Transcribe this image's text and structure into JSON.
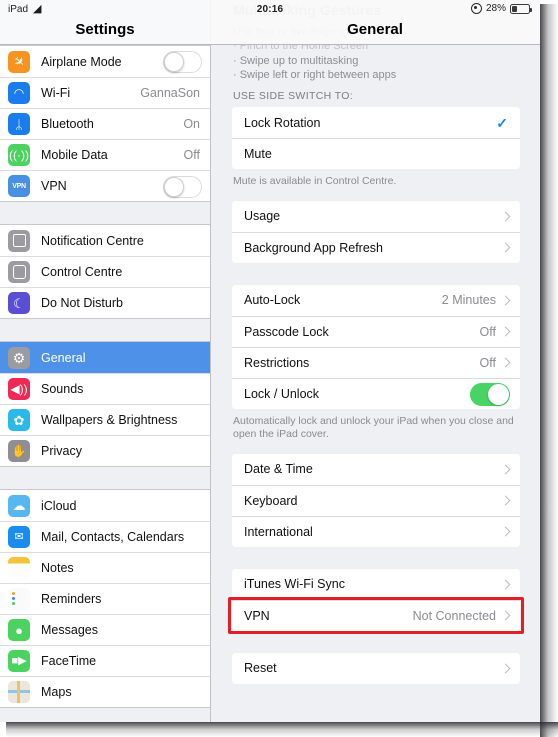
{
  "status_bar": {
    "device_label": "iPad",
    "wifi_icon": "wifi-icon",
    "time": "20:16",
    "rotation_lock_icon": "rotation-lock-icon",
    "battery_percent": "28%",
    "battery_level": 28
  },
  "sidebar": {
    "title": "Settings",
    "groups": [
      {
        "items": [
          {
            "label": "Airplane Mode",
            "icon": "airplane-icon",
            "icon_color": "#f79421",
            "accessory": "toggle",
            "toggle_on": false
          },
          {
            "label": "Wi-Fi",
            "icon": "wifi-icon",
            "icon_color": "#1a7ced",
            "value": "GannaSon",
            "accessory": "value"
          },
          {
            "label": "Bluetooth",
            "icon": "bluetooth-icon",
            "icon_color": "#1a7ced",
            "value": "On",
            "accessory": "value"
          },
          {
            "label": "Mobile Data",
            "icon": "cellular-icon",
            "icon_color": "#4cd35f",
            "value": "Off",
            "accessory": "value"
          },
          {
            "label": "VPN",
            "icon": "vpn-icon",
            "icon_color": "#4a90e2",
            "accessory": "toggle",
            "toggle_on": false
          }
        ]
      },
      {
        "items": [
          {
            "label": "Notification Centre",
            "icon": "notification-centre-icon",
            "icon_color": "#9b9ba0",
            "accessory": "none"
          },
          {
            "label": "Control Centre",
            "icon": "control-centre-icon",
            "icon_color": "#9b9ba0",
            "accessory": "none"
          },
          {
            "label": "Do Not Disturb",
            "icon": "moon-icon",
            "icon_color": "#5a4fd4",
            "accessory": "none"
          }
        ]
      },
      {
        "items": [
          {
            "label": "General",
            "icon": "gear-icon",
            "icon_color": "#9b9ba0",
            "accessory": "none",
            "selected": true
          },
          {
            "label": "Sounds",
            "icon": "speaker-icon",
            "icon_color": "#ee2a54",
            "accessory": "none"
          },
          {
            "label": "Wallpapers & Brightness",
            "icon": "wallpaper-icon",
            "icon_color": "#2ab9e8",
            "accessory": "none"
          },
          {
            "label": "Privacy",
            "icon": "hand-icon",
            "icon_color": "#8e8e93",
            "accessory": "none"
          }
        ]
      },
      {
        "items": [
          {
            "label": "iCloud",
            "icon": "icloud-icon",
            "icon_color": "#57b7f0",
            "accessory": "none"
          },
          {
            "label": "Mail, Contacts, Calendars",
            "icon": "mail-icon",
            "icon_color": "#1a8cf0",
            "accessory": "none"
          },
          {
            "label": "Notes",
            "icon": "notes-icon",
            "icon_color": "#f5c33a",
            "accessory": "none"
          },
          {
            "label": "Reminders",
            "icon": "reminders-icon",
            "icon_color": "#f4f4f5",
            "accessory": "none"
          },
          {
            "label": "Messages",
            "icon": "messages-icon",
            "icon_color": "#4cd35f",
            "accessory": "none"
          },
          {
            "label": "FaceTime",
            "icon": "facetime-icon",
            "icon_color": "#4cd35f",
            "accessory": "none"
          },
          {
            "label": "Maps",
            "icon": "maps-icon",
            "icon_color": "#e8e3d8",
            "accessory": "none"
          }
        ]
      }
    ]
  },
  "detail": {
    "title": "General",
    "scrolled_above": {
      "heading": "Multitasking Gestures",
      "subtitle": "Use four or five fingers to:",
      "bullets": [
        "· Pinch to the Home Screen",
        "· Swipe up to multitasking",
        "· Swipe left or right between apps"
      ]
    },
    "sections": [
      {
        "header": "USE SIDE SWITCH TO:",
        "footer": "Mute is available in Control Centre.",
        "rows": [
          {
            "label": "Lock Rotation",
            "accessory": "check",
            "checked": true
          },
          {
            "label": "Mute",
            "accessory": "none"
          }
        ]
      },
      {
        "rows": [
          {
            "label": "Usage",
            "accessory": "chevron"
          },
          {
            "label": "Background App Refresh",
            "accessory": "chevron"
          }
        ]
      },
      {
        "footer": "Automatically lock and unlock your iPad when you close and open the iPad cover.",
        "rows": [
          {
            "label": "Auto-Lock",
            "value": "2 Minutes",
            "accessory": "chevron"
          },
          {
            "label": "Passcode Lock",
            "value": "Off",
            "accessory": "chevron"
          },
          {
            "label": "Restrictions",
            "value": "Off",
            "accessory": "chevron"
          },
          {
            "label": "Lock / Unlock",
            "accessory": "toggle",
            "toggle_on": true
          }
        ]
      },
      {
        "rows": [
          {
            "label": "Date & Time",
            "accessory": "chevron"
          },
          {
            "label": "Keyboard",
            "accessory": "chevron"
          },
          {
            "label": "International",
            "accessory": "chevron"
          }
        ]
      },
      {
        "rows": [
          {
            "label": "iTunes Wi-Fi Sync",
            "accessory": "chevron"
          },
          {
            "label": "VPN",
            "value": "Not Connected",
            "accessory": "chevron",
            "highlighted": true
          }
        ]
      },
      {
        "rows": [
          {
            "label": "Reset",
            "accessory": "chevron"
          }
        ]
      }
    ]
  },
  "annotation": {
    "target": "VPN",
    "color": "#e21f26"
  }
}
